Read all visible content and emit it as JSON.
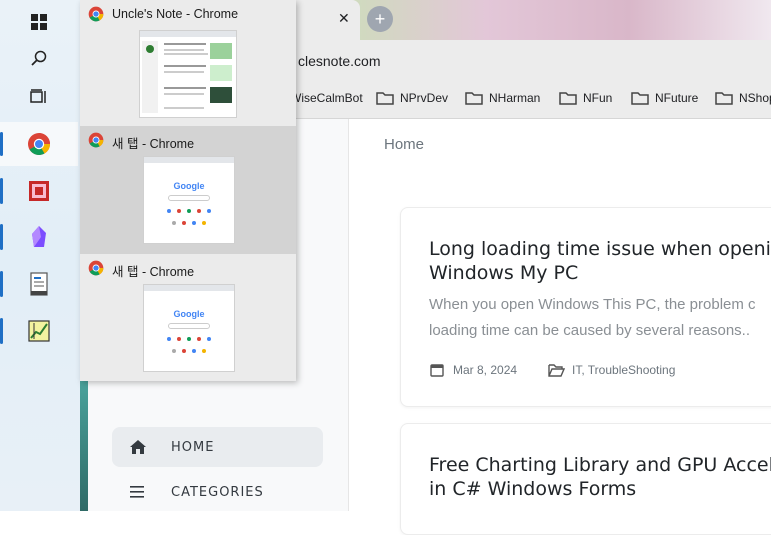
{
  "taskbar": {
    "icons": [
      "windows-start-icon",
      "search-icon",
      "task-view-icon",
      "chrome-icon",
      "app-red-icon",
      "obsidian-icon",
      "notepad-icon",
      "charting-app-icon"
    ]
  },
  "popup": {
    "items": [
      {
        "title": "Uncle's Note - Chrome"
      },
      {
        "title": "새 탭 - Chrome"
      },
      {
        "title": "새 탭 - Chrome"
      }
    ],
    "google_text": "Google"
  },
  "browser": {
    "url": "clesnote.com",
    "bookmarks": [
      "WiseCalmBot",
      "NPrvDev",
      "NHarman",
      "NFun",
      "NFuture",
      "NShop"
    ]
  },
  "sidebar": {
    "nav": [
      {
        "label": "HOME"
      },
      {
        "label": "CATEGORIES"
      }
    ]
  },
  "content": {
    "breadcrumb": "Home",
    "posts": [
      {
        "title_line1": "Long loading time issue when opening",
        "title_line2": "Windows My PC",
        "excerpt_line1": "When you open Windows This PC, the problem c",
        "excerpt_line2": "loading time can be caused by several reasons..",
        "date": "Mar 8, 2024",
        "categories": "IT, TroubleShooting"
      },
      {
        "title_line1": "Free Charting Library and GPU Accelera",
        "title_line2": "in C# Windows Forms"
      }
    ]
  },
  "colors": {
    "accent": "#1f6fc5",
    "taskbar_bg": "#e4eff7",
    "popup_bg": "#ebebeb"
  }
}
